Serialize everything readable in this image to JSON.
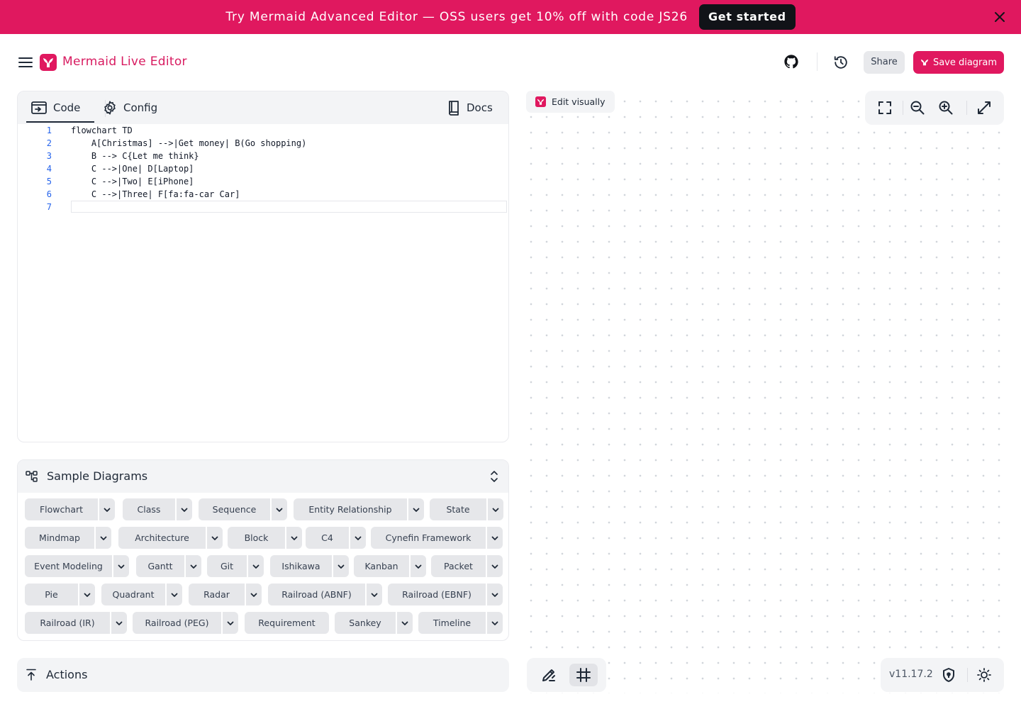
{
  "banner": {
    "text": "Try Mermaid Advanced Editor — OSS users get 10% off with code JS26",
    "cta": "Get started"
  },
  "header": {
    "title": "Mermaid Live Editor",
    "share": "Share",
    "save": "Save diagram"
  },
  "editor": {
    "tabs": {
      "code": "Code",
      "config": "Config",
      "docs": "Docs"
    },
    "lines": [
      {
        "n": "1",
        "text": "flowchart TD"
      },
      {
        "n": "2",
        "text": "    A[Christmas] -->|Get money| B(Go shopping)"
      },
      {
        "n": "3",
        "text": "    B --> C{Let me think}"
      },
      {
        "n": "4",
        "text": "    C -->|One| D[Laptop]"
      },
      {
        "n": "5",
        "text": "    C -->|Two| E[iPhone]"
      },
      {
        "n": "6",
        "text": "    C -->|Three| F[fa:fa-car Car]"
      },
      {
        "n": "7",
        "text": ""
      }
    ]
  },
  "samples": {
    "title": "Sample Diagrams",
    "items": [
      "Flowchart",
      "Class",
      "Sequence",
      "Entity Relationship",
      "State",
      "Mindmap",
      "Architecture",
      "Block",
      "C4",
      "Cynefin Framework",
      "Event Modeling",
      "Gantt",
      "Git",
      "Ishikawa",
      "Kanban",
      "Packet",
      "Pie",
      "Quadrant",
      "Radar",
      "Railroad (ABNF)",
      "Railroad (EBNF)",
      "Railroad (IR)",
      "Railroad (PEG)",
      "Requirement",
      "Sankey",
      "Timeline"
    ]
  },
  "actions": {
    "title": "Actions"
  },
  "canvas": {
    "edit_visually": "Edit visually",
    "version": "v11.17.2"
  },
  "colors": {
    "brand": "#e0185f",
    "code_number": "#2563eb"
  }
}
